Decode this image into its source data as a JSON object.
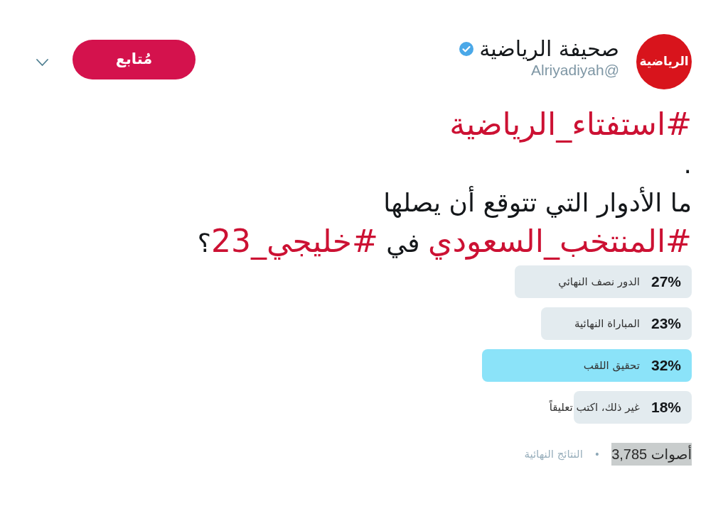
{
  "account": {
    "avatar_text": "الرياضية",
    "name": "صحيفة الرياضية",
    "verified": true,
    "handle": "@Alriyadiyah"
  },
  "follow_button": {
    "label": "مُتابع"
  },
  "tweet": {
    "lines": [
      [
        {
          "kind": "hashtag",
          "text": "#استفتاء_الرياضية"
        }
      ],
      [
        {
          "kind": "text",
          "text": "."
        }
      ],
      [
        {
          "kind": "text",
          "text": "ما الأدوار التي تتوقع أن يصلها"
        }
      ],
      [
        {
          "kind": "hashtag",
          "text": "#المنتخب_السعودي"
        },
        {
          "kind": "text",
          "text": " في "
        },
        {
          "kind": "hashtag",
          "text": "#خليجي_23"
        },
        {
          "kind": "text",
          "text": "؟"
        }
      ]
    ]
  },
  "poll": {
    "options": [
      {
        "percent": "27%",
        "label": "الدور نصف النهائي",
        "level": 0.27,
        "highlighted": false
      },
      {
        "percent": "23%",
        "label": "المباراة النهائية",
        "level": 0.23,
        "highlighted": false
      },
      {
        "percent": "32%",
        "label": "تحقيق اللقب",
        "level": 0.32,
        "highlighted": true
      },
      {
        "percent": "18%",
        "label": "غير ذلك، اكتب تعليقاً",
        "level": 0.18,
        "highlighted": false
      }
    ],
    "footer": {
      "votes": "أصوات 3,785",
      "votes_highlighted": true,
      "separator": "•",
      "status": "النتائج النهائية"
    }
  }
}
